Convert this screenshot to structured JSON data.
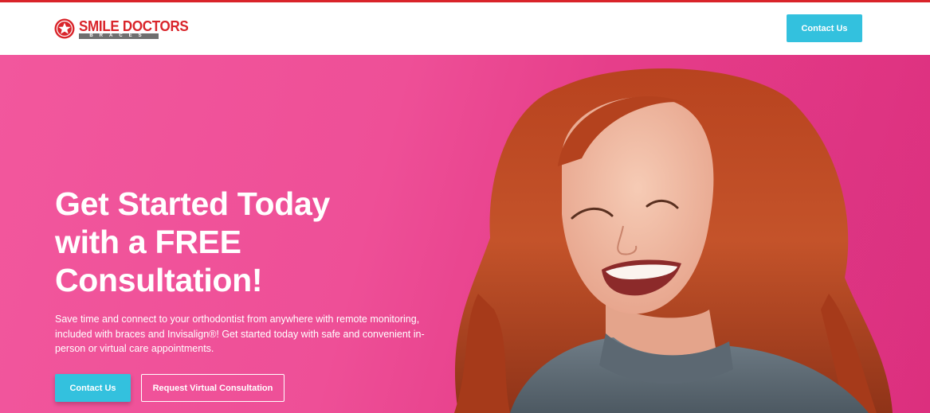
{
  "header": {
    "logo": {
      "name": "SMILE DOCTORS",
      "sub": "BRACES"
    },
    "contact_label": "Contact Us"
  },
  "hero": {
    "title_lines": [
      "Get Started Today",
      "with a FREE",
      "Consultation!"
    ],
    "body": "Save time and connect to your orthodontist from anywhere with remote monitoring, included with braces and Invisalign®!  Get started today with safe and convenient in-person or virtual care appointments.",
    "contact_label": "Contact Us",
    "virtual_label": "Request Virtual Consultation",
    "photo_icon": "smiling-woman-photo"
  },
  "colors": {
    "brand_red": "#d9242a",
    "accent_teal": "#33c1de",
    "hero_pink": "#ee4f97"
  }
}
